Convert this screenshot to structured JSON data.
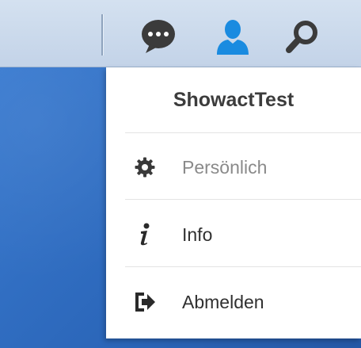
{
  "toolbar": {
    "icons": {
      "chat": "chat-bubble-icon",
      "user": "user-icon",
      "search": "search-icon"
    },
    "colors": {
      "chat": "#3b3b3b",
      "user": "#1a8be0",
      "search": "#3b3b3b"
    }
  },
  "user_menu": {
    "username": "ShowactTest",
    "items": [
      {
        "label": "Persönlich",
        "icon": "gear-icon",
        "state": "disabled"
      },
      {
        "label": "Info",
        "icon": "info-icon",
        "state": "normal"
      },
      {
        "label": "Abmelden",
        "icon": "logout-icon",
        "state": "normal"
      }
    ]
  }
}
